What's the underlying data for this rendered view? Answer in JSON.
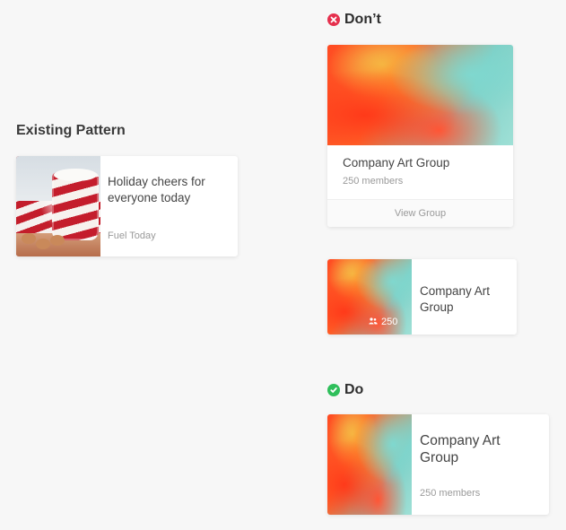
{
  "existing": {
    "section_title": "Existing Pattern",
    "card": {
      "title": "Holiday cheers for everyone today",
      "source": "Fuel Today"
    }
  },
  "dont": {
    "label": "Don’t",
    "icon": "x-circle-icon",
    "color": "#e5304d",
    "card_large": {
      "title": "Company Art Group",
      "members": "250 members",
      "action": "View Group"
    },
    "card_small": {
      "title": "Company Art Group",
      "member_count": "250",
      "member_icon": "people-icon"
    }
  },
  "do": {
    "label": "Do",
    "icon": "check-circle-icon",
    "color": "#2fbf5b",
    "card": {
      "title": "Company Art Group",
      "members": "250 members"
    }
  }
}
